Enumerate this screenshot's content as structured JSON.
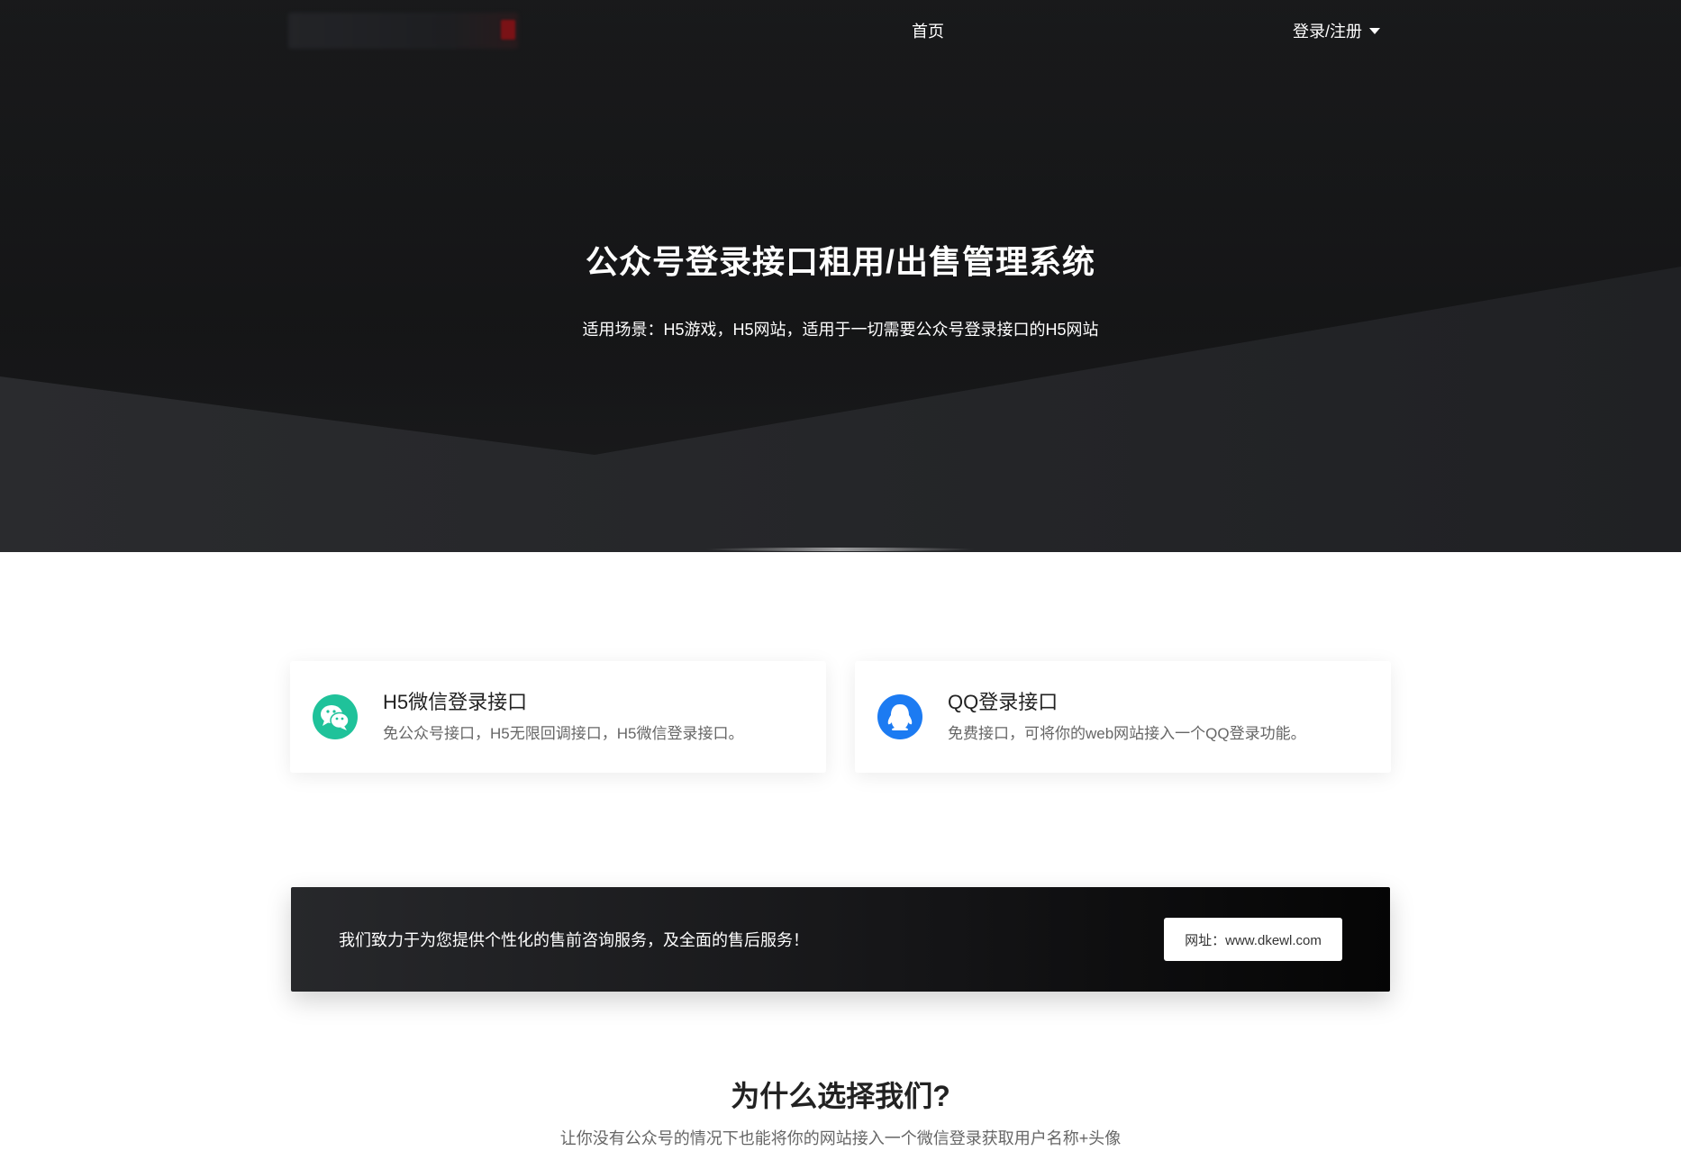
{
  "nav": {
    "home": "首页",
    "login": "登录/注册"
  },
  "hero": {
    "title": "公众号登录接口租用/出售管理系统",
    "subtitle": "适用场景：H5游戏，H5网站，适用于一切需要公众号登录接口的H5网站"
  },
  "features": [
    {
      "title": "H5微信登录接口",
      "desc": "免公众号接口，H5无限回调接口，H5微信登录接口。",
      "icon": "wechat-icon",
      "color": "#1fc29a"
    },
    {
      "title": "QQ登录接口",
      "desc": "免费接口，可将你的web网站接入一个QQ登录功能。",
      "icon": "qq-icon",
      "color": "#1c7bf2"
    }
  ],
  "cta": {
    "text": "我们致力于为您提供个性化的售前咨询服务，及全面的售后服务！",
    "button": "网址：www.dkewl.com"
  },
  "why": {
    "title": "为什么选择我们?",
    "subtitle": "让你没有公众号的情况下也能将你的网站接入一个微信登录获取用户名称+头像"
  }
}
